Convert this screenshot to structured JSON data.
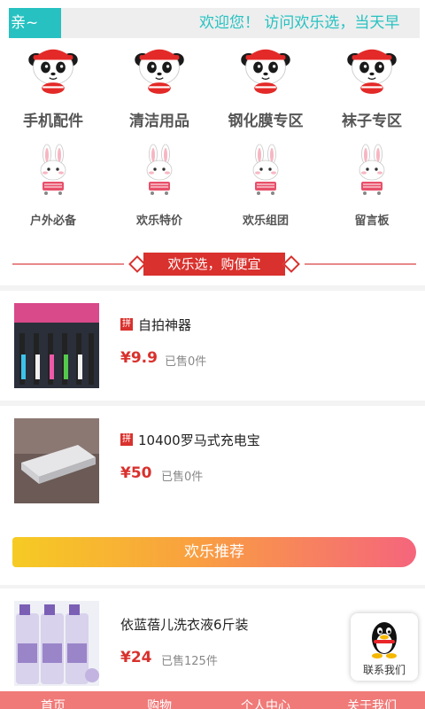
{
  "notice": {
    "tag": "亲~",
    "text": "欢迎您！ 访问欢乐选，当天早"
  },
  "categories_row1": [
    {
      "label": "手机配件",
      "icon": "panda-icon"
    },
    {
      "label": "清洁用品",
      "icon": "panda-icon"
    },
    {
      "label": "钢化膜专区",
      "icon": "panda-icon"
    },
    {
      "label": "袜子专区",
      "icon": "panda-icon"
    }
  ],
  "categories_row2": [
    {
      "label": "户外必备",
      "icon": "rabbit-icon"
    },
    {
      "label": "欢乐特价",
      "icon": "rabbit-icon"
    },
    {
      "label": "欢乐组团",
      "icon": "rabbit-icon"
    },
    {
      "label": "留言板",
      "icon": "rabbit-icon"
    }
  ],
  "section1_title": "欢乐选，购便宜",
  "products": [
    {
      "pin": "拼",
      "name": "自拍神器",
      "price": "¥9.9",
      "sold": "已售0件"
    },
    {
      "pin": "拼",
      "name": "10400罗马式充电宝",
      "price": "¥50",
      "sold": "已售0件"
    }
  ],
  "section2_title": "欢乐推荐",
  "recommended": [
    {
      "name": "依蓝蓓儿洗衣液6斤装",
      "price": "¥24",
      "sold": "已售125件"
    }
  ],
  "contact": {
    "label": "联系我们",
    "icon": "qq-penguin-icon"
  },
  "tabs": [
    {
      "label": "首页"
    },
    {
      "label": "购物"
    },
    {
      "label": "个人中心"
    },
    {
      "label": "关于我们"
    }
  ],
  "colors": {
    "accent_teal": "#27c1c1",
    "brand_red": "#d9312d",
    "tabbar": "#f07a78"
  }
}
